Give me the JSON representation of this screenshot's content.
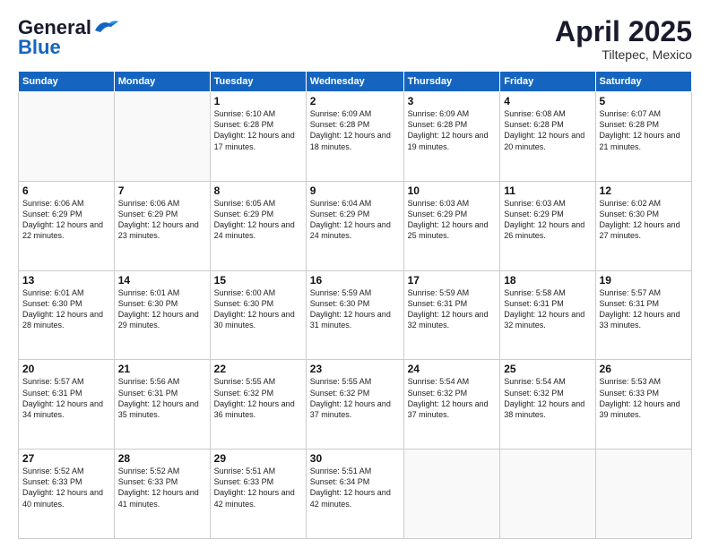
{
  "header": {
    "logo_line1": "General",
    "logo_line2": "Blue",
    "month_year": "April 2025",
    "location": "Tiltepec, Mexico"
  },
  "days_of_week": [
    "Sunday",
    "Monday",
    "Tuesday",
    "Wednesday",
    "Thursday",
    "Friday",
    "Saturday"
  ],
  "weeks": [
    [
      {
        "day": "",
        "info": ""
      },
      {
        "day": "",
        "info": ""
      },
      {
        "day": "1",
        "sunrise": "6:10 AM",
        "sunset": "6:28 PM",
        "daylight": "12 hours and 17 minutes."
      },
      {
        "day": "2",
        "sunrise": "6:09 AM",
        "sunset": "6:28 PM",
        "daylight": "12 hours and 18 minutes."
      },
      {
        "day": "3",
        "sunrise": "6:09 AM",
        "sunset": "6:28 PM",
        "daylight": "12 hours and 19 minutes."
      },
      {
        "day": "4",
        "sunrise": "6:08 AM",
        "sunset": "6:28 PM",
        "daylight": "12 hours and 20 minutes."
      },
      {
        "day": "5",
        "sunrise": "6:07 AM",
        "sunset": "6:28 PM",
        "daylight": "12 hours and 21 minutes."
      }
    ],
    [
      {
        "day": "6",
        "sunrise": "6:06 AM",
        "sunset": "6:29 PM",
        "daylight": "12 hours and 22 minutes."
      },
      {
        "day": "7",
        "sunrise": "6:06 AM",
        "sunset": "6:29 PM",
        "daylight": "12 hours and 23 minutes."
      },
      {
        "day": "8",
        "sunrise": "6:05 AM",
        "sunset": "6:29 PM",
        "daylight": "12 hours and 24 minutes."
      },
      {
        "day": "9",
        "sunrise": "6:04 AM",
        "sunset": "6:29 PM",
        "daylight": "12 hours and 24 minutes."
      },
      {
        "day": "10",
        "sunrise": "6:03 AM",
        "sunset": "6:29 PM",
        "daylight": "12 hours and 25 minutes."
      },
      {
        "day": "11",
        "sunrise": "6:03 AM",
        "sunset": "6:29 PM",
        "daylight": "12 hours and 26 minutes."
      },
      {
        "day": "12",
        "sunrise": "6:02 AM",
        "sunset": "6:30 PM",
        "daylight": "12 hours and 27 minutes."
      }
    ],
    [
      {
        "day": "13",
        "sunrise": "6:01 AM",
        "sunset": "6:30 PM",
        "daylight": "12 hours and 28 minutes."
      },
      {
        "day": "14",
        "sunrise": "6:01 AM",
        "sunset": "6:30 PM",
        "daylight": "12 hours and 29 minutes."
      },
      {
        "day": "15",
        "sunrise": "6:00 AM",
        "sunset": "6:30 PM",
        "daylight": "12 hours and 30 minutes."
      },
      {
        "day": "16",
        "sunrise": "5:59 AM",
        "sunset": "6:30 PM",
        "daylight": "12 hours and 31 minutes."
      },
      {
        "day": "17",
        "sunrise": "5:59 AM",
        "sunset": "6:31 PM",
        "daylight": "12 hours and 32 minutes."
      },
      {
        "day": "18",
        "sunrise": "5:58 AM",
        "sunset": "6:31 PM",
        "daylight": "12 hours and 32 minutes."
      },
      {
        "day": "19",
        "sunrise": "5:57 AM",
        "sunset": "6:31 PM",
        "daylight": "12 hours and 33 minutes."
      }
    ],
    [
      {
        "day": "20",
        "sunrise": "5:57 AM",
        "sunset": "6:31 PM",
        "daylight": "12 hours and 34 minutes."
      },
      {
        "day": "21",
        "sunrise": "5:56 AM",
        "sunset": "6:31 PM",
        "daylight": "12 hours and 35 minutes."
      },
      {
        "day": "22",
        "sunrise": "5:55 AM",
        "sunset": "6:32 PM",
        "daylight": "12 hours and 36 minutes."
      },
      {
        "day": "23",
        "sunrise": "5:55 AM",
        "sunset": "6:32 PM",
        "daylight": "12 hours and 37 minutes."
      },
      {
        "day": "24",
        "sunrise": "5:54 AM",
        "sunset": "6:32 PM",
        "daylight": "12 hours and 37 minutes."
      },
      {
        "day": "25",
        "sunrise": "5:54 AM",
        "sunset": "6:32 PM",
        "daylight": "12 hours and 38 minutes."
      },
      {
        "day": "26",
        "sunrise": "5:53 AM",
        "sunset": "6:33 PM",
        "daylight": "12 hours and 39 minutes."
      }
    ],
    [
      {
        "day": "27",
        "sunrise": "5:52 AM",
        "sunset": "6:33 PM",
        "daylight": "12 hours and 40 minutes."
      },
      {
        "day": "28",
        "sunrise": "5:52 AM",
        "sunset": "6:33 PM",
        "daylight": "12 hours and 41 minutes."
      },
      {
        "day": "29",
        "sunrise": "5:51 AM",
        "sunset": "6:33 PM",
        "daylight": "12 hours and 42 minutes."
      },
      {
        "day": "30",
        "sunrise": "5:51 AM",
        "sunset": "6:34 PM",
        "daylight": "12 hours and 42 minutes."
      },
      {
        "day": "",
        "info": ""
      },
      {
        "day": "",
        "info": ""
      },
      {
        "day": "",
        "info": ""
      }
    ]
  ]
}
